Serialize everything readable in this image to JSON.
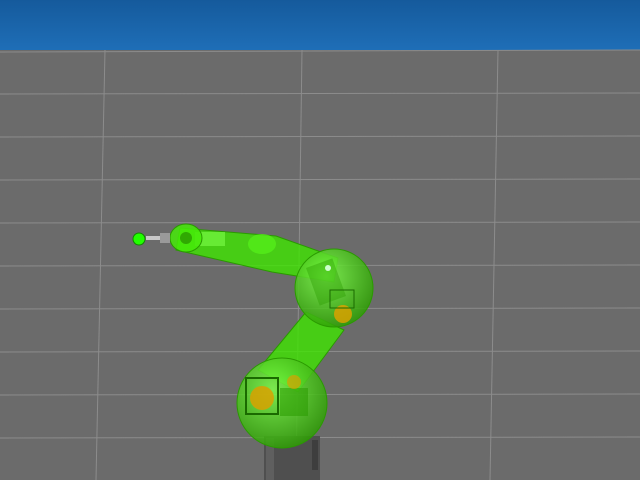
{
  "scene": {
    "sky_color": "#1f6fb8",
    "sky_color_dark": "#155a9c",
    "floor_color": "#6b6b6b",
    "grid_color": "#8a8a8a",
    "robot_highlight_color": "#39e000",
    "robot_highlight_dark": "#2a9a00",
    "robot_link_color": "#c8c8c8",
    "pedestal_color": "#5a5a5a",
    "joint_accent_color": "#d9a100",
    "target_marker_color": "#22ff00"
  },
  "robot": {
    "name_icon": "robot-arm-icon",
    "links": [
      "base",
      "shoulder",
      "upper-arm",
      "elbow",
      "forearm",
      "wrist",
      "end-effector"
    ]
  }
}
